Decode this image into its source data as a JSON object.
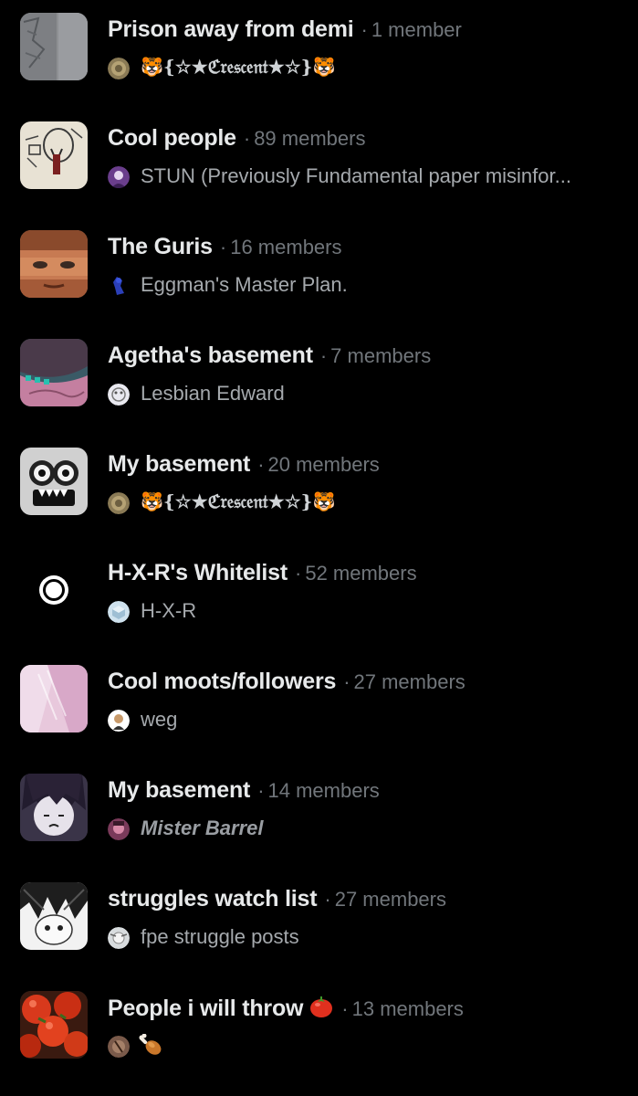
{
  "separator": "·",
  "lists": [
    {
      "name": "Prison away from demi",
      "members": "1 member",
      "owner": "🐯{☆★ℭ𝔯𝔢𝔰𝔠𝔢𝔫𝔱★☆}🐯",
      "thumb_icon": "sketch-thumbnail",
      "avatar_icon": "coin-avatar"
    },
    {
      "name": "Cool people",
      "members": "89 members",
      "owner": "STUN (Previously Fundamental paper misinfor...",
      "thumb_icon": "drawing-thumbnail",
      "avatar_icon": "character-avatar"
    },
    {
      "name": "The Guris",
      "members": "16 members",
      "owner": "Eggman's Master Plan.",
      "thumb_icon": "face-thumbnail",
      "avatar_icon": "figure-avatar"
    },
    {
      "name": "Agetha's basement",
      "members": "7 members",
      "owner": "Lesbian Edward",
      "thumb_icon": "cartoon-thumbnail",
      "avatar_icon": "sketch-avatar"
    },
    {
      "name": "My basement",
      "members": "20 members",
      "owner": "🐯{☆★ℭ𝔯𝔢𝔰𝔠𝔢𝔫𝔱★☆}🐯",
      "thumb_icon": "goggles-thumbnail",
      "avatar_icon": "coin-avatar"
    },
    {
      "name": "H-X-R's Whitelist",
      "members": "52 members",
      "owner": "H-X-R",
      "thumb_icon": "ring-thumbnail",
      "avatar_icon": "cube-avatar"
    },
    {
      "name": "Cool moots/followers",
      "members": "27 members",
      "owner": "weg",
      "thumb_icon": "pastel-thumbnail",
      "avatar_icon": "white-avatar"
    },
    {
      "name": "My basement",
      "members": "14 members",
      "owner": "Mister Barrel",
      "thumb_icon": "anime-thumbnail",
      "avatar_icon": "pink-avatar"
    },
    {
      "name": "struggles watch list",
      "members": "27 members",
      "owner": "fpe struggle posts",
      "thumb_icon": "manga-thumbnail",
      "avatar_icon": "grey-avatar"
    },
    {
      "name": "People i will throw",
      "members": "13 members",
      "owner": "🍗",
      "thumb_icon": "tomato-thumbnail",
      "avatar_icon": "brown-avatar",
      "title_emoji": "tomato-icon"
    }
  ]
}
